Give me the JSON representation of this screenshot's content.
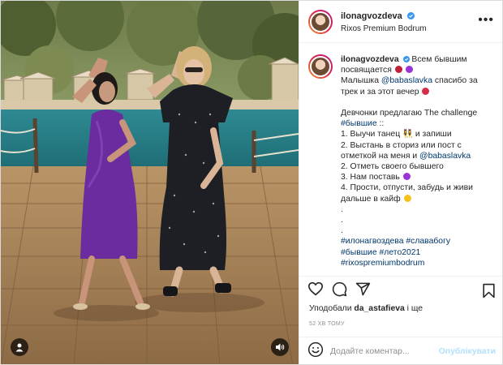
{
  "post": {
    "username": "ilonagvozdeva",
    "location": "Rixos Premium Bodrum"
  },
  "caption": {
    "username": "ilonagvozdeva",
    "line1": "Всем бывшим",
    "line2": "посвящается",
    "line3_prefix": "Малышка ",
    "line3_mention": "@babaslavka",
    "line3_suffix": " спасибо за",
    "line4": "трек и за этот вечер",
    "line5": "Девчонки предлагаю The challenge",
    "line6_tag": "#бывшие",
    "line6_suffix": " ::",
    "line7": "1. Выучи танец 👯‍♀️ и запиши",
    "line8": "2. Выстань в сториз или пост с",
    "line9_prefix": "отметкой на меня и ",
    "line9_mention": "@babaslavka",
    "line10": "2. Отметь своего бывшего",
    "line11": "3. Нам поставь",
    "line12": "4. Прости, отпусти, забудь и живи",
    "line13": "дальше в кайф",
    "line14": ".",
    "line15": ".",
    "line16": ".",
    "tags1": "#илонагвоздева #славабогу",
    "tags2": "#бывшие #лето2021",
    "tags3": "#rixospremiumbodrum"
  },
  "likes": {
    "prefix": "Уподобали ",
    "user": "da_astafieva",
    "suffix": " і ще"
  },
  "time": "52 ХВ ТОМУ",
  "comment": {
    "placeholder": "Додайте коментар...",
    "publish": "Опублікувати"
  },
  "colors": {
    "link": "#00376b",
    "publish_disabled": "#b2dffc",
    "verified": "#3897f0"
  },
  "icons": {
    "like": "heart-icon",
    "comment": "comment-icon",
    "share": "share-icon",
    "save": "bookmark-icon",
    "emoji": "smiley-icon",
    "user": "user-icon",
    "sound": "speaker-icon"
  }
}
